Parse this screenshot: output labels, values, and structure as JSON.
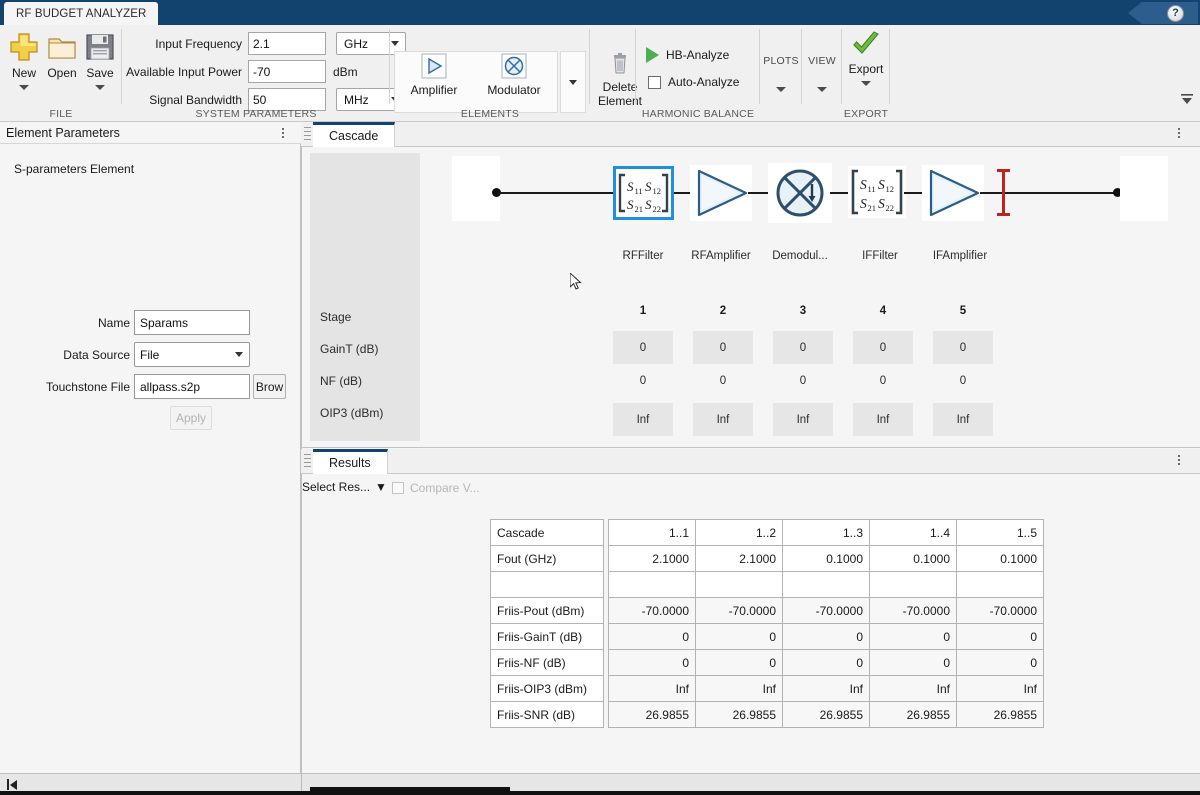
{
  "titlebar": {
    "app_tab": "RF BUDGET ANALYZER",
    "help_icon": "help-question-icon",
    "help_label": "?"
  },
  "ribbon": {
    "file": {
      "group_label": "FILE",
      "buttons": [
        {
          "label": "New",
          "icon": "plus-new-icon",
          "has_caret": true
        },
        {
          "label": "Open",
          "icon": "folder-open-icon",
          "has_caret": false
        },
        {
          "label": "Save",
          "icon": "floppy-save-icon",
          "has_caret": true
        }
      ]
    },
    "system_parameters": {
      "group_label": "SYSTEM PARAMETERS",
      "rows": [
        {
          "label": "Input Frequency",
          "value": "2.1",
          "unit": "GHz",
          "unit_is_dropdown": true
        },
        {
          "label": "Available Input Power",
          "value": "-70",
          "unit": "dBm",
          "unit_is_dropdown": false
        },
        {
          "label": "Signal Bandwidth",
          "value": "50",
          "unit": "MHz",
          "unit_is_dropdown": true
        }
      ]
    },
    "elements": {
      "group_label": "ELEMENTS",
      "buttons": [
        {
          "label": "Amplifier",
          "icon": "amplifier-triangle-icon"
        },
        {
          "label": "Modulator",
          "icon": "modulator-mixer-icon"
        }
      ],
      "more_icon": "chevron-down-icon"
    },
    "delete": {
      "label_line1": "Delete",
      "label_line2": "Element",
      "icon": "trash-icon"
    },
    "harmonic_balance": {
      "group_label": "HARMONIC BALANCE",
      "analyze_label": "HB-Analyze",
      "analyze_icon": "play-green-icon",
      "auto_label": "Auto-Analyze",
      "auto_checked": false
    },
    "plots": {
      "label": "PLOTS",
      "caret_icon": "chevron-down-icon"
    },
    "view": {
      "label": "VIEW",
      "caret_icon": "chevron-down-icon"
    },
    "export": {
      "label": "Export",
      "group_label": "EXPORT",
      "icon": "green-check-icon",
      "caret_icon": "chevron-down-icon"
    },
    "collapse_icon": "collapse-ribbon-icon"
  },
  "left_panel": {
    "title": "Element Parameters",
    "menu_icon": "kebab-menu-icon",
    "section_title": "S-parameters Element",
    "fields": [
      {
        "label": "Name",
        "value": "Sparams",
        "type": "text"
      },
      {
        "label": "Data Source",
        "value": "File",
        "type": "dropdown"
      },
      {
        "label": "Touchstone File",
        "value": "allpass.s2p",
        "type": "text",
        "button": "Brow"
      }
    ],
    "apply_label": "Apply"
  },
  "cascade_panel": {
    "tab_label": "Cascade",
    "menu_icon": "kebab-menu-icon",
    "grip_icon": "panel-grip-icon",
    "row_labels": [
      "Stage",
      "GainT (dB)",
      "NF (dB)",
      "OIP3 (dBm)"
    ],
    "elements": [
      {
        "name": "RFFilter",
        "icon": "s-parameters-icon",
        "selected": true
      },
      {
        "name": "RFAmplifier",
        "icon": "amplifier-triangle-icon",
        "selected": false
      },
      {
        "name": "Demodul...",
        "icon": "modulator-mixer-icon",
        "selected": false
      },
      {
        "name": "IFFilter",
        "icon": "s-parameters-icon",
        "selected": false
      },
      {
        "name": "IFAmplifier",
        "icon": "amplifier-triangle-icon",
        "selected": false
      }
    ],
    "stages": [
      "1",
      "2",
      "3",
      "4",
      "5"
    ],
    "gaint": [
      "0",
      "0",
      "0",
      "0",
      "0"
    ],
    "nf": [
      "0",
      "0",
      "0",
      "0",
      "0"
    ],
    "oip3": [
      "Inf",
      "Inf",
      "Inf",
      "Inf",
      "Inf"
    ],
    "sparam_glyph": {
      "s11": "S",
      "s11sub": "11",
      "s12": "S",
      "s12sub": "12",
      "s21": "S",
      "s21sub": "21",
      "s22": "S",
      "s22sub": "22"
    },
    "selection_color": "#1f8fe0",
    "terminator_color": "#c0221f"
  },
  "results_panel": {
    "tab_label": "Results",
    "menu_icon": "kebab-menu-icon",
    "grip_icon": "panel-grip-icon",
    "select_results_label": "Select Res...",
    "select_results_caret": "▼",
    "compare_label": "Compare V...",
    "compare_checked": false,
    "table": {
      "row_headers": [
        "Cascade",
        "Fout (GHz)",
        "",
        "Friis-Pout (dBm)",
        "Friis-GainT (dB)",
        "Friis-NF (dB)",
        "Friis-OIP3 (dBm)",
        "Friis-SNR (dB)"
      ],
      "rows": [
        {
          "header": "Cascade",
          "shaded": false,
          "values": [
            "1..1",
            "1..2",
            "1..3",
            "1..4",
            "1..5"
          ]
        },
        {
          "header": "Fout (GHz)",
          "shaded": false,
          "values": [
            "2.1000",
            "2.1000",
            "0.1000",
            "0.1000",
            "0.1000"
          ]
        },
        {
          "header": "",
          "shaded": false,
          "values": [
            "",
            "",
            "",
            "",
            ""
          ]
        },
        {
          "header": "Friis-Pout (dBm)",
          "shaded": true,
          "values": [
            "-70.0000",
            "-70.0000",
            "-70.0000",
            "-70.0000",
            "-70.0000"
          ]
        },
        {
          "header": "Friis-GainT (dB)",
          "shaded": true,
          "values": [
            "0",
            "0",
            "0",
            "0",
            "0"
          ]
        },
        {
          "header": "Friis-NF (dB)",
          "shaded": true,
          "values": [
            "0",
            "0",
            "0",
            "0",
            "0"
          ]
        },
        {
          "header": "Friis-OIP3 (dBm)",
          "shaded": true,
          "values": [
            "Inf",
            "Inf",
            "Inf",
            "Inf",
            "Inf"
          ]
        },
        {
          "header": "Friis-SNR (dB)",
          "shaded": true,
          "values": [
            "26.9855",
            "26.9855",
            "26.9855",
            "26.9855",
            "26.9855"
          ]
        }
      ]
    }
  },
  "statusbar": {
    "icon": "jump-to-start-icon"
  },
  "colors": {
    "title_bar": "#11436e",
    "accent": "#1f8fe0",
    "panel_bg": "#f5f5f5",
    "terminator": "#c0221f"
  }
}
